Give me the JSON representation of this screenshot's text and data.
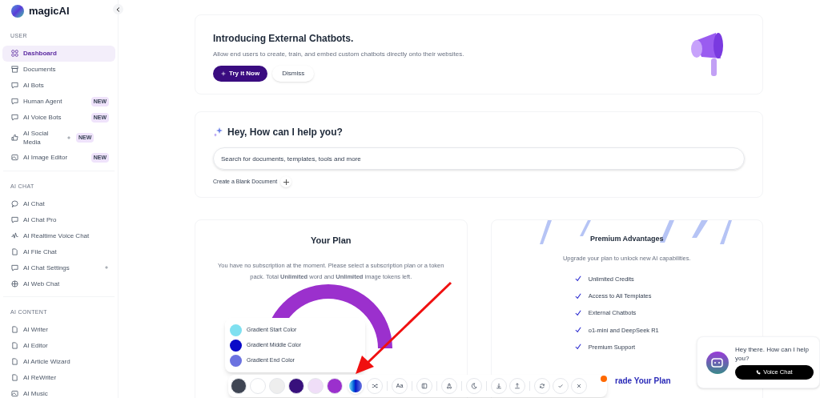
{
  "brand": {
    "name": "magicAI"
  },
  "sidebar": {
    "sections": [
      {
        "title": "USER",
        "items": [
          {
            "label": "Dashboard",
            "selected": true
          },
          {
            "label": "Documents",
            "selected": false
          },
          {
            "label": "AI Bots",
            "selected": false
          },
          {
            "label": "Human Agent",
            "selected": false,
            "badge": "NEW"
          },
          {
            "label": "AI Voice Bots",
            "selected": false,
            "badge": "NEW"
          },
          {
            "label": "AI Social Media",
            "selected": false,
            "badge": "NEW",
            "plus": true
          },
          {
            "label": "AI Image Editor",
            "selected": false,
            "badge": "NEW"
          }
        ]
      },
      {
        "title": "AI CHAT",
        "items": [
          {
            "label": "AI Chat",
            "selected": false
          },
          {
            "label": "AI Chat Pro",
            "selected": false
          },
          {
            "label": "AI Realtime Voice Chat",
            "selected": false
          },
          {
            "label": "AI File Chat",
            "selected": false
          },
          {
            "label": "AI Chat Settings",
            "selected": false,
            "plus": true
          },
          {
            "label": "AI Web Chat",
            "selected": false
          }
        ]
      },
      {
        "title": "AI CONTENT",
        "items": [
          {
            "label": "AI Writer",
            "selected": false
          },
          {
            "label": "AI Editor",
            "selected": false
          },
          {
            "label": "AI Article Wizard",
            "selected": false
          },
          {
            "label": "AI ReWriter",
            "selected": false
          },
          {
            "label": "AI Music",
            "selected": false
          }
        ]
      }
    ]
  },
  "announcement": {
    "title": "Introducing External Chatbots.",
    "text": "Allow end users to create, train, and embed custom chatbots directly onto their websites.",
    "primary_button": "Try it Now",
    "secondary_button": "Dismiss"
  },
  "assistant": {
    "title": "Hey, How can I help you?",
    "search": {
      "placeholder": "Search for documents, templates, tools and more"
    },
    "blank_document": "Create a Blank Document"
  },
  "plan": {
    "title": "Your Plan",
    "text": "You have no subscription at the moment. Please select a subscription plan or a token pack. Total **Unlimited** word and **Unlimited** image tokens left."
  },
  "premium": {
    "title": "Premium Advantages",
    "subtitle": "Upgrade your plan to unlock new AI capabilities.",
    "features": [
      "Unlimited Credits",
      "Access to All Templates",
      "External Chatbots",
      "o1-mini and DeepSeek R1",
      "Premium Support"
    ],
    "upgrade": "rade Your Plan"
  },
  "gradient_popover": {
    "items": [
      {
        "label": "Gradient Start Color",
        "color": "#7fe0f0"
      },
      {
        "label": "Gradient Middle Color",
        "color": "#0a0ac8"
      },
      {
        "label": "Gradient End Color",
        "color": "#6b72e0"
      }
    ]
  },
  "toolbar": {
    "swatches": [
      {
        "color": "#3f4553",
        "selected": false
      },
      {
        "color": "#ffffff",
        "selected": false
      },
      {
        "color": "#eeeeee",
        "selected": false
      },
      {
        "color": "#38107c",
        "selected": false
      },
      {
        "color": "#f0def8",
        "selected": false
      },
      {
        "color": "#9b30cd",
        "selected": false
      }
    ],
    "font_button": "Aa"
  },
  "chat_widget": {
    "text": "Hey there. How can I help you?",
    "button": "Voice Chat"
  }
}
